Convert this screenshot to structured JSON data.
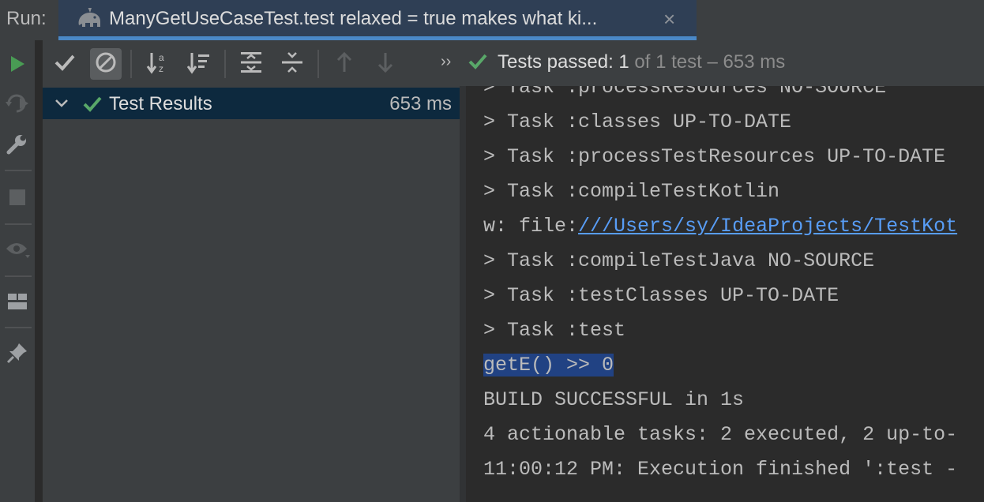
{
  "run_bar": {
    "label": "Run:",
    "tab_title": "ManyGetUseCaseTest.test relaxed = true makes what ki...",
    "close_glyph": "×"
  },
  "colors": {
    "accent": "#4a88c7",
    "pass_green": "#59a869",
    "run_green": "#499c54",
    "selection": "#214283",
    "link": "#589df6"
  },
  "left_toolbar": [
    "run-icon",
    "rerun-failed-icon",
    "wrench-icon",
    "stop-icon",
    "eye-icon",
    "layout-icon",
    "pin-icon"
  ],
  "toolbar": {
    "more_glyph": "››",
    "status_prefix": "Tests passed: 1",
    "status_suffix": " of 1 test – 653 ms"
  },
  "tree": {
    "root_label": "Test Results",
    "root_time": "653 ms"
  },
  "console": {
    "lines": [
      "> Task :processResources NO-SOURCE",
      "> Task :classes UP-TO-DATE",
      "> Task :processTestResources UP-TO-DATE",
      "> Task :compileTestKotlin",
      "w: file:",
      "> Task :compileTestJava NO-SOURCE",
      "> Task :testClasses UP-TO-DATE",
      "> Task :test",
      "getE() >> 0",
      "BUILD SUCCESSFUL in 1s",
      "4 actionable tasks: 2 executed, 2 up-to-",
      "11:00:12 PM: Execution finished ':test -"
    ],
    "link_text": "///Users/sy/IdeaProjects/TestKot"
  }
}
